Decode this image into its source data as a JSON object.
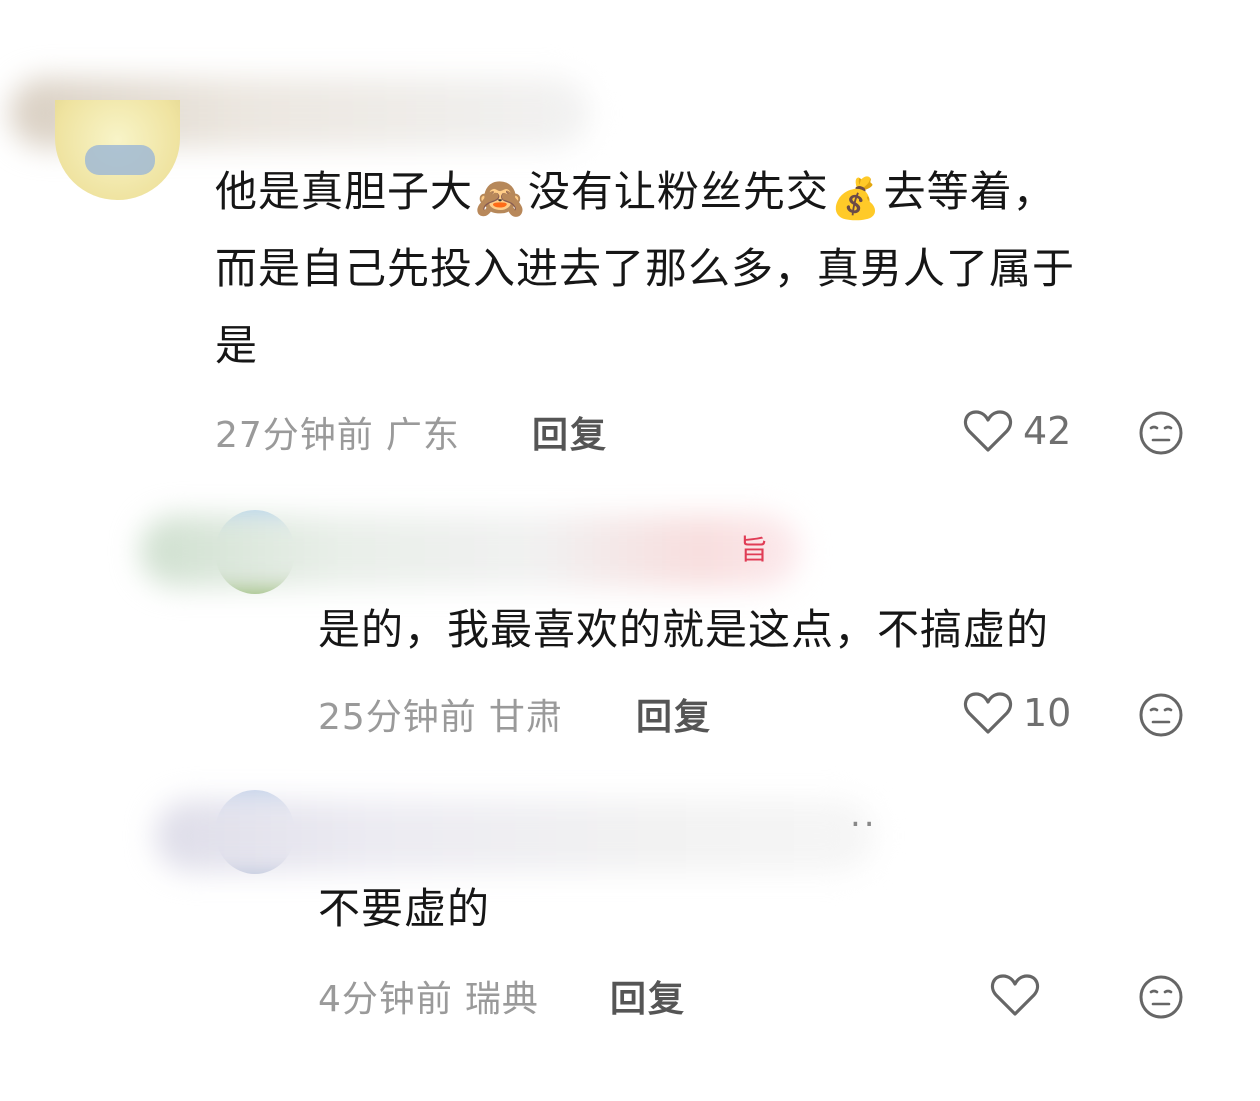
{
  "comments": [
    {
      "text_lines": [
        "他是真胆子大",
        "没有让粉丝先交",
        "去等着，",
        "而是自己先投入进去了那么多，真男人了属于",
        "是"
      ],
      "emoji_1": "🙈",
      "emoji_2": "💰",
      "time": "27分钟前",
      "location": "广东",
      "reply_label": "回复",
      "likes": "42",
      "like_icon": "heart-outline-icon",
      "face_icon": "neutral-face-icon"
    },
    {
      "text": "是的，我最喜欢的就是这点，不搞虚的",
      "time": "25分钟前",
      "location": "甘肃",
      "reply_label": "回复",
      "likes": "10",
      "badge_char": "旨"
    },
    {
      "text": "不要虚的",
      "time": "4分钟前",
      "location": "瑞典",
      "reply_label": "回复",
      "likes": "",
      "ellipsis": ".."
    }
  ]
}
